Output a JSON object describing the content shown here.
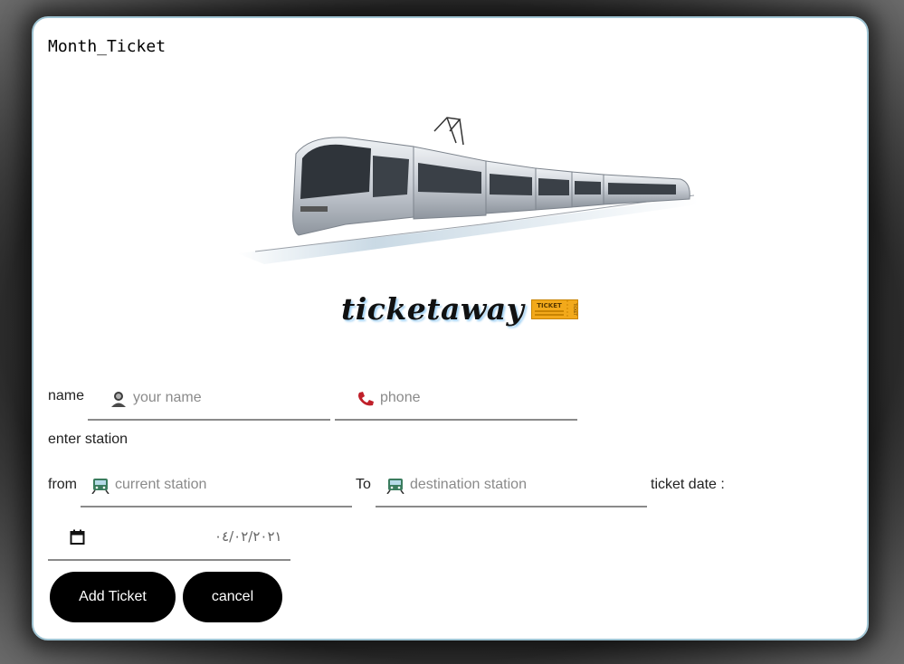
{
  "page": {
    "title": "Month_Ticket"
  },
  "brand": {
    "name": "ticketaway",
    "ticket_badge": "TICKET",
    "ticket_stub": "TICKET"
  },
  "form": {
    "name_label": "name",
    "name_placeholder": "your name",
    "phone_placeholder": "phone",
    "enter_station_label": "enter station",
    "from_label": "from",
    "from_placeholder": "current station",
    "to_label": "To",
    "to_placeholder": "destination station",
    "ticket_date_label": "ticket date :",
    "ticket_date_value": "٠٤/٠٢/٢٠٢١"
  },
  "buttons": {
    "add": "Add Ticket",
    "cancel": "cancel"
  },
  "icons": {
    "person": "person-icon",
    "phone": "phone-icon",
    "train": "train-icon",
    "calendar": "calendar-icon",
    "ticket": "ticket-icon"
  },
  "colors": {
    "button_bg": "#000000",
    "card_border": "#9fc4d3",
    "brand_shadow": "#9fd0f3",
    "ticket_gold": "#f2a91b",
    "phone_red": "#c0202a"
  }
}
